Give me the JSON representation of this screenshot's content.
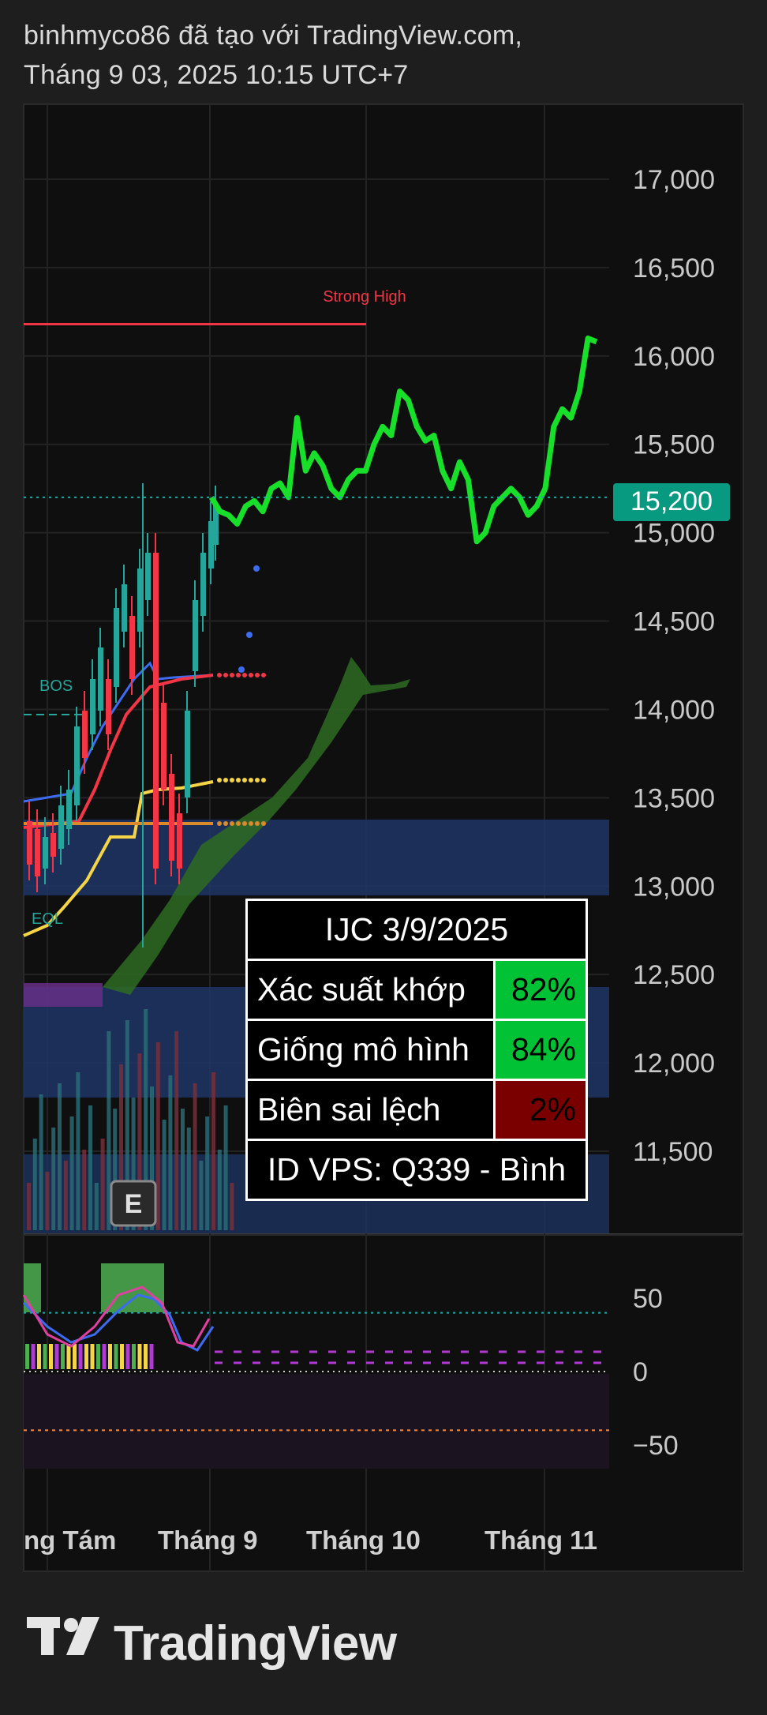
{
  "header": {
    "line1": "binhmyco86 đã tạo với TradingView.com,",
    "line2": "Tháng 9 03, 2025 10:15 UTC+7"
  },
  "chart_data": {
    "type": "candlestick",
    "symbol": "IJC",
    "price_axis": {
      "ticks": [
        "17,000",
        "16,500",
        "16,000",
        "15,500",
        "15,000",
        "14,500",
        "14,000",
        "13,500",
        "13,000",
        "12,500",
        "12,000",
        "11,500"
      ],
      "values": [
        17000,
        16500,
        16000,
        15500,
        15000,
        14500,
        14000,
        13500,
        13000,
        12500,
        12000,
        11500
      ]
    },
    "last_price": {
      "label": "15,200",
      "value": 15200,
      "color": "#089981"
    },
    "time_axis": [
      "ng Tám",
      "Tháng 9",
      "Tháng 10",
      "Tháng 11"
    ],
    "annotations": {
      "strong_high": "Strong High",
      "bos": "BOS",
      "eql": "EQL",
      "earnings": "E"
    },
    "strong_high_level": 16180,
    "projection": {
      "color": "#18e02a",
      "points": [
        [
          0,
          15200
        ],
        [
          2,
          15120
        ],
        [
          4,
          15100
        ],
        [
          6,
          15050
        ],
        [
          8,
          15150
        ],
        [
          10,
          15180
        ],
        [
          12,
          15120
        ],
        [
          14,
          15250
        ],
        [
          16,
          15280
        ],
        [
          18,
          15200
        ],
        [
          20,
          15650
        ],
        [
          22,
          15350
        ],
        [
          24,
          15450
        ],
        [
          26,
          15380
        ],
        [
          28,
          15250
        ],
        [
          30,
          15200
        ],
        [
          32,
          15300
        ],
        [
          34,
          15350
        ],
        [
          36,
          15350
        ],
        [
          38,
          15500
        ],
        [
          40,
          15600
        ],
        [
          42,
          15550
        ],
        [
          44,
          15800
        ],
        [
          46,
          15750
        ],
        [
          48,
          15600
        ],
        [
          50,
          15520
        ],
        [
          52,
          15550
        ],
        [
          54,
          15350
        ],
        [
          56,
          15250
        ],
        [
          58,
          15400
        ],
        [
          60,
          15300
        ],
        [
          62,
          14950
        ],
        [
          64,
          15000
        ],
        [
          66,
          15150
        ],
        [
          68,
          15200
        ],
        [
          70,
          15250
        ],
        [
          72,
          15200
        ],
        [
          74,
          15100
        ],
        [
          76,
          15150
        ],
        [
          78,
          15250
        ],
        [
          80,
          15600
        ],
        [
          82,
          15700
        ],
        [
          84,
          15650
        ],
        [
          86,
          15800
        ],
        [
          88,
          16100
        ],
        [
          90,
          16080
        ]
      ]
    },
    "oscillator": {
      "ticks": [
        "50",
        "0",
        "−50"
      ],
      "values": [
        50,
        0,
        -50
      ]
    },
    "colors": {
      "up": "#26a69a",
      "down": "#f23645",
      "background": "#0f0f0f"
    }
  },
  "info_table": {
    "title": "IJC 3/9/2025",
    "rows": [
      {
        "label": "Xác suất khớp",
        "value": "82%",
        "color": "#00c234"
      },
      {
        "label": "Giống mô hình",
        "value": "84%",
        "color": "#00c234"
      },
      {
        "label": "Biên sai lệch",
        "value": "2%",
        "color": "#7a0000"
      }
    ],
    "footer": "ID VPS: Q339 - Bình"
  },
  "footer": {
    "brand": "TradingView"
  }
}
